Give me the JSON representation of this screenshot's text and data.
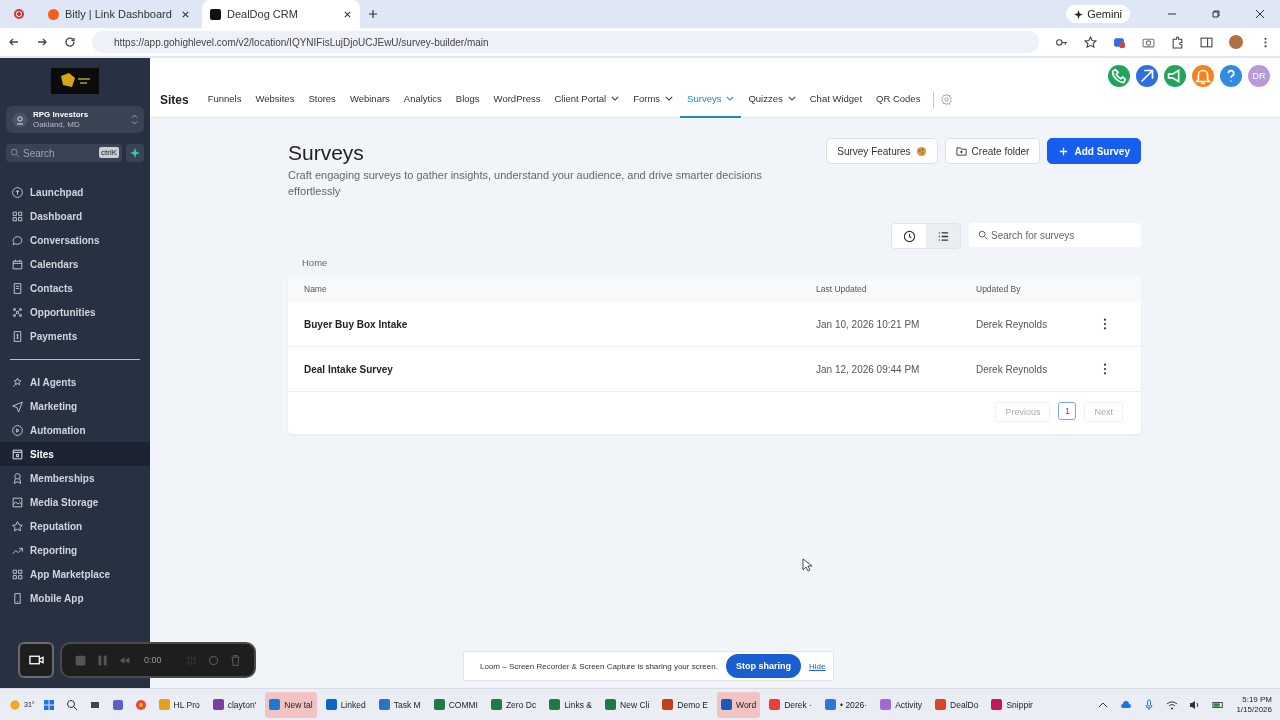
{
  "browser": {
    "tabs": [
      {
        "title": "Bitly | Link Dashboard",
        "selected": false
      },
      {
        "title": "DealDog CRM",
        "selected": true
      }
    ],
    "gemini": "Gemini",
    "url": "https://app.gohighlevel.com/v2/location/IQYNIFisLujDjoUCJEwU/survey-builder/main"
  },
  "sidebar": {
    "account": {
      "name": "RPG Investors",
      "location": "Oakland, MD"
    },
    "search": {
      "placeholder": "Search",
      "shortcut": "ctrlK"
    },
    "groups": [
      [
        {
          "label": "Launchpad",
          "selected": false
        },
        {
          "label": "Dashboard",
          "selected": false
        },
        {
          "label": "Conversations",
          "selected": false
        },
        {
          "label": "Calendars",
          "selected": false
        },
        {
          "label": "Contacts",
          "selected": false
        },
        {
          "label": "Opportunities",
          "selected": false
        },
        {
          "label": "Payments",
          "selected": false
        }
      ],
      [
        {
          "label": "AI Agents",
          "selected": false
        },
        {
          "label": "Marketing",
          "selected": false
        },
        {
          "label": "Automation",
          "selected": false
        },
        {
          "label": "Sites",
          "selected": true
        },
        {
          "label": "Memberships",
          "selected": false
        },
        {
          "label": "Media Storage",
          "selected": false
        },
        {
          "label": "Reputation",
          "selected": false
        },
        {
          "label": "Reporting",
          "selected": false
        },
        {
          "label": "App Marketplace",
          "selected": false
        },
        {
          "label": "Mobile App",
          "selected": false
        }
      ]
    ]
  },
  "nav": {
    "title": "Sites",
    "items": [
      {
        "label": "Funnels",
        "dropdown": false,
        "selected": false
      },
      {
        "label": "Websites",
        "dropdown": false,
        "selected": false
      },
      {
        "label": "Stores",
        "dropdown": false,
        "selected": false
      },
      {
        "label": "Webinars",
        "dropdown": false,
        "selected": false
      },
      {
        "label": "Analytics",
        "dropdown": false,
        "selected": false
      },
      {
        "label": "Blogs",
        "dropdown": false,
        "selected": false
      },
      {
        "label": "WordPress",
        "dropdown": false,
        "selected": false
      },
      {
        "label": "Client Portal",
        "dropdown": true,
        "selected": false
      },
      {
        "label": "Forms",
        "dropdown": true,
        "selected": false
      },
      {
        "label": "Surveys",
        "dropdown": true,
        "selected": true
      },
      {
        "label": "Quizzes",
        "dropdown": true,
        "selected": false
      },
      {
        "label": "Chat Widget",
        "dropdown": false,
        "selected": false
      },
      {
        "label": "QR Codes",
        "dropdown": false,
        "selected": false
      }
    ],
    "avatar": "DR"
  },
  "page": {
    "title": "Surveys",
    "description": "Craft engaging surveys to gather insights, understand your audience, and drive smarter decisions effortlessly",
    "buttons": [
      {
        "label": "Survey Features",
        "kind": "features"
      },
      {
        "label": "Create folder",
        "kind": "folder"
      },
      {
        "label": "Add Survey",
        "kind": "primary"
      }
    ],
    "views": [
      {
        "selected": false
      },
      {
        "selected": true
      }
    ],
    "search": {
      "placeholder": "Search for surveys"
    },
    "breadcrumb": "Home",
    "columns": [
      "Name",
      "Last Updated",
      "Updated By"
    ],
    "rows": [
      {
        "name": "Buyer Buy Box Intake",
        "updated": "Jan 10, 2026 10:21 PM",
        "by": "Derek Reynolds"
      },
      {
        "name": "Deal Intake Survey",
        "updated": "Jan 12, 2026 09:44 PM",
        "by": "Derek Reynolds"
      }
    ],
    "pagination": {
      "previous": "Previous",
      "pages": [
        {
          "label": "1",
          "selected": true
        }
      ],
      "next": "Next"
    }
  },
  "recorder": {
    "time": "0:00"
  },
  "loom": {
    "message": "Loom – Screen Recorder & Screen Capture is sharing your screen.",
    "stop": "Stop sharing",
    "hide": "Hide"
  },
  "taskbar": {
    "weather": "31°",
    "apps": [
      {
        "label": "HL Pro",
        "active": false
      },
      {
        "label": "clayton'",
        "active": false
      },
      {
        "label": "New tal",
        "active": true
      },
      {
        "label": "Linked",
        "active": false
      },
      {
        "label": "Task M",
        "active": false
      },
      {
        "label": "COMMI",
        "active": false
      },
      {
        "label": "Zero Dc",
        "active": false
      },
      {
        "label": "Links &",
        "active": false
      },
      {
        "label": "New Cli",
        "active": false
      },
      {
        "label": "Demo E",
        "active": false
      },
      {
        "label": "Word",
        "active": true
      },
      {
        "label": "Derek ·",
        "active": false
      },
      {
        "label": "• 2026·",
        "active": false
      },
      {
        "label": "Activity",
        "active": false
      },
      {
        "label": "DealDo",
        "active": false
      },
      {
        "label": "Snippir",
        "active": false
      }
    ],
    "time": "5:19 PM",
    "date": "1/15/2026"
  }
}
